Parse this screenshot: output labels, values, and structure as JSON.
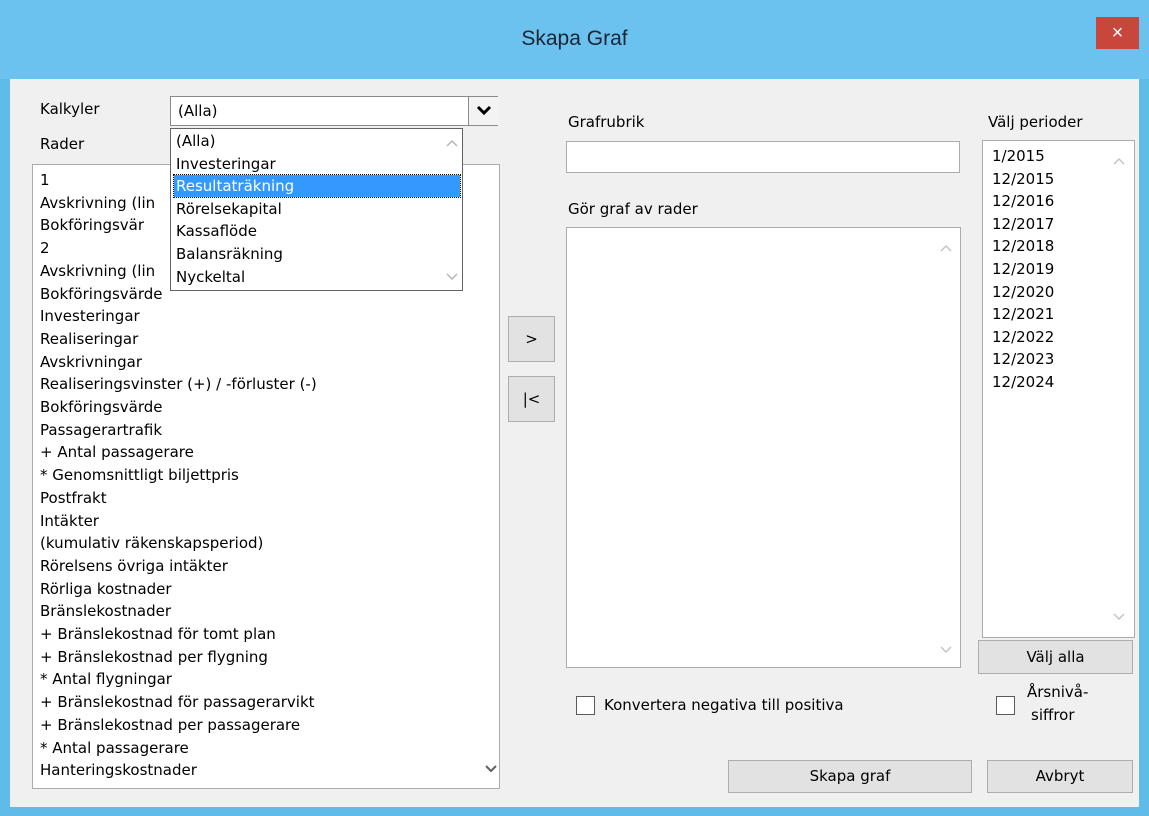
{
  "window": {
    "title": "Skapa Graf",
    "close": "×"
  },
  "kalkyler": {
    "label": "Kalkyler",
    "selected": "(Alla)",
    "arrow": "⌄",
    "options": [
      "(Alla)",
      "Investeringar",
      "Resultaträkning",
      "Rörelsekapital",
      "Kassaflöde",
      "Balansräkning",
      "Nyckeltal"
    ],
    "highlighted": "Resultaträkning"
  },
  "rader": {
    "label": "Rader",
    "items": [
      "1",
      "Avskrivning (lin",
      "Bokföringsvär",
      "2",
      "Avskrivning (lin",
      "Bokföringsvärde",
      "Investeringar",
      "Realiseringar",
      "Avskrivningar",
      "Realiseringsvinster (+) / -förluster (-)",
      "Bokföringsvärde",
      "Passagerartrafik",
      "+ Antal passagerare",
      "* Genomsnittligt biljettpris",
      "Postfrakt",
      "Intäkter",
      "(kumulativ räkenskapsperiod)",
      "Rörelsens övriga intäkter",
      "Rörliga kostnader",
      "Bränslekostnader",
      "+ Bränslekostnad för tomt plan",
      "+ Bränslekostnad per flygning",
      "* Antal flygningar",
      "+ Bränslekostnad för passagerarvikt",
      "+ Bränslekostnad per passagerare",
      "* Antal passagerare",
      "Hanteringskostnader"
    ]
  },
  "buttons": {
    "add": ">",
    "remove": "|<",
    "select_all": "Välj alla",
    "create": "Skapa graf",
    "cancel": "Avbryt"
  },
  "grafrubrik": {
    "label": "Grafrubrik",
    "value": ""
  },
  "graf_rader": {
    "label": "Gör graf av rader",
    "items": []
  },
  "perioder": {
    "label": "Välj perioder",
    "items": [
      "1/2015",
      "12/2015",
      "12/2016",
      "12/2017",
      "12/2018",
      "12/2019",
      "12/2020",
      "12/2021",
      "12/2022",
      "12/2023",
      "12/2024"
    ]
  },
  "options": {
    "convert_negative": "Konvertera negativa till positiva",
    "convert_checked": false,
    "year_level_1": "Årsnivå-",
    "year_level_2": "siffror",
    "year_level_checked": false
  },
  "colors": {
    "titlebar": "#6cc2ef",
    "close": "#c9463d",
    "highlight": "#3399ff"
  }
}
